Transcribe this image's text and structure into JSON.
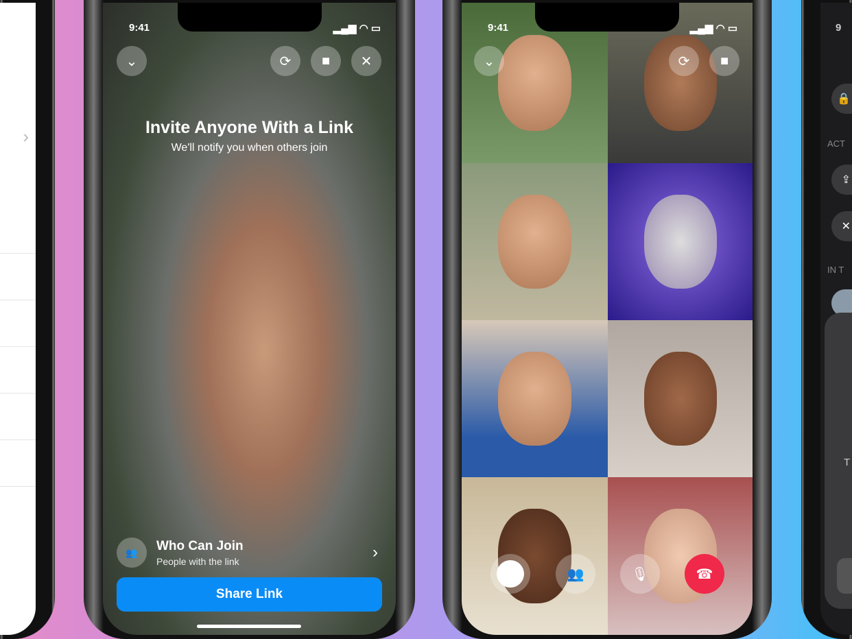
{
  "phone1": {
    "chevron": "›"
  },
  "phone2": {
    "time": "9:41",
    "title": "Invite Anyone With a Link",
    "subtitle": "We'll notify you when others join",
    "who_title": "Who Can Join",
    "who_sub": "People with the link",
    "share": "Share Link",
    "icons": [
      "chevron-down-icon",
      "flip-camera-icon",
      "video-camera-icon",
      "close-icon",
      "people-icon",
      "chevron-right-icon"
    ]
  },
  "phone3": {
    "time": "9:41",
    "tiles": 8,
    "icons": [
      "chevron-down-icon",
      "flip-camera-icon",
      "video-camera-icon",
      "capture-button",
      "people-icon",
      "microphone-icon",
      "end-call-icon"
    ],
    "colors": {
      "end_call": "#f02849"
    }
  },
  "phone4": {
    "time": "9",
    "section1": "ACT",
    "section2": "IN T",
    "partial": "T"
  },
  "colors": {
    "accent": "#0a8cf7"
  }
}
